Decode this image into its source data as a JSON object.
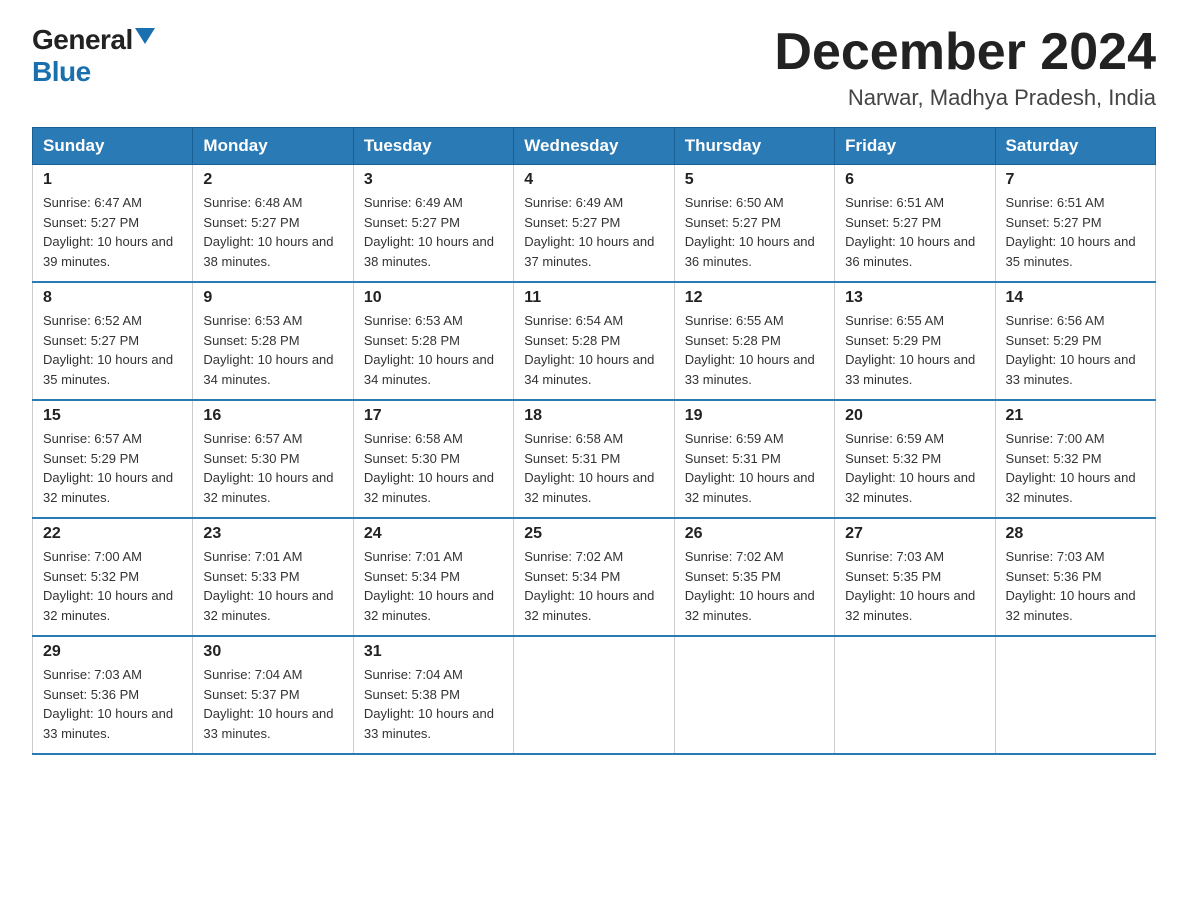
{
  "logo": {
    "general": "General",
    "blue": "Blue"
  },
  "title": "December 2024",
  "subtitle": "Narwar, Madhya Pradesh, India",
  "days_header": [
    "Sunday",
    "Monday",
    "Tuesday",
    "Wednesday",
    "Thursday",
    "Friday",
    "Saturday"
  ],
  "weeks": [
    [
      {
        "day": "1",
        "sunrise": "6:47 AM",
        "sunset": "5:27 PM",
        "daylight": "10 hours and 39 minutes."
      },
      {
        "day": "2",
        "sunrise": "6:48 AM",
        "sunset": "5:27 PM",
        "daylight": "10 hours and 38 minutes."
      },
      {
        "day": "3",
        "sunrise": "6:49 AM",
        "sunset": "5:27 PM",
        "daylight": "10 hours and 38 minutes."
      },
      {
        "day": "4",
        "sunrise": "6:49 AM",
        "sunset": "5:27 PM",
        "daylight": "10 hours and 37 minutes."
      },
      {
        "day": "5",
        "sunrise": "6:50 AM",
        "sunset": "5:27 PM",
        "daylight": "10 hours and 36 minutes."
      },
      {
        "day": "6",
        "sunrise": "6:51 AM",
        "sunset": "5:27 PM",
        "daylight": "10 hours and 36 minutes."
      },
      {
        "day": "7",
        "sunrise": "6:51 AM",
        "sunset": "5:27 PM",
        "daylight": "10 hours and 35 minutes."
      }
    ],
    [
      {
        "day": "8",
        "sunrise": "6:52 AM",
        "sunset": "5:27 PM",
        "daylight": "10 hours and 35 minutes."
      },
      {
        "day": "9",
        "sunrise": "6:53 AM",
        "sunset": "5:28 PM",
        "daylight": "10 hours and 34 minutes."
      },
      {
        "day": "10",
        "sunrise": "6:53 AM",
        "sunset": "5:28 PM",
        "daylight": "10 hours and 34 minutes."
      },
      {
        "day": "11",
        "sunrise": "6:54 AM",
        "sunset": "5:28 PM",
        "daylight": "10 hours and 34 minutes."
      },
      {
        "day": "12",
        "sunrise": "6:55 AM",
        "sunset": "5:28 PM",
        "daylight": "10 hours and 33 minutes."
      },
      {
        "day": "13",
        "sunrise": "6:55 AM",
        "sunset": "5:29 PM",
        "daylight": "10 hours and 33 minutes."
      },
      {
        "day": "14",
        "sunrise": "6:56 AM",
        "sunset": "5:29 PM",
        "daylight": "10 hours and 33 minutes."
      }
    ],
    [
      {
        "day": "15",
        "sunrise": "6:57 AM",
        "sunset": "5:29 PM",
        "daylight": "10 hours and 32 minutes."
      },
      {
        "day": "16",
        "sunrise": "6:57 AM",
        "sunset": "5:30 PM",
        "daylight": "10 hours and 32 minutes."
      },
      {
        "day": "17",
        "sunrise": "6:58 AM",
        "sunset": "5:30 PM",
        "daylight": "10 hours and 32 minutes."
      },
      {
        "day": "18",
        "sunrise": "6:58 AM",
        "sunset": "5:31 PM",
        "daylight": "10 hours and 32 minutes."
      },
      {
        "day": "19",
        "sunrise": "6:59 AM",
        "sunset": "5:31 PM",
        "daylight": "10 hours and 32 minutes."
      },
      {
        "day": "20",
        "sunrise": "6:59 AM",
        "sunset": "5:32 PM",
        "daylight": "10 hours and 32 minutes."
      },
      {
        "day": "21",
        "sunrise": "7:00 AM",
        "sunset": "5:32 PM",
        "daylight": "10 hours and 32 minutes."
      }
    ],
    [
      {
        "day": "22",
        "sunrise": "7:00 AM",
        "sunset": "5:32 PM",
        "daylight": "10 hours and 32 minutes."
      },
      {
        "day": "23",
        "sunrise": "7:01 AM",
        "sunset": "5:33 PM",
        "daylight": "10 hours and 32 minutes."
      },
      {
        "day": "24",
        "sunrise": "7:01 AM",
        "sunset": "5:34 PM",
        "daylight": "10 hours and 32 minutes."
      },
      {
        "day": "25",
        "sunrise": "7:02 AM",
        "sunset": "5:34 PM",
        "daylight": "10 hours and 32 minutes."
      },
      {
        "day": "26",
        "sunrise": "7:02 AM",
        "sunset": "5:35 PM",
        "daylight": "10 hours and 32 minutes."
      },
      {
        "day": "27",
        "sunrise": "7:03 AM",
        "sunset": "5:35 PM",
        "daylight": "10 hours and 32 minutes."
      },
      {
        "day": "28",
        "sunrise": "7:03 AM",
        "sunset": "5:36 PM",
        "daylight": "10 hours and 32 minutes."
      }
    ],
    [
      {
        "day": "29",
        "sunrise": "7:03 AM",
        "sunset": "5:36 PM",
        "daylight": "10 hours and 33 minutes."
      },
      {
        "day": "30",
        "sunrise": "7:04 AM",
        "sunset": "5:37 PM",
        "daylight": "10 hours and 33 minutes."
      },
      {
        "day": "31",
        "sunrise": "7:04 AM",
        "sunset": "5:38 PM",
        "daylight": "10 hours and 33 minutes."
      },
      null,
      null,
      null,
      null
    ]
  ]
}
